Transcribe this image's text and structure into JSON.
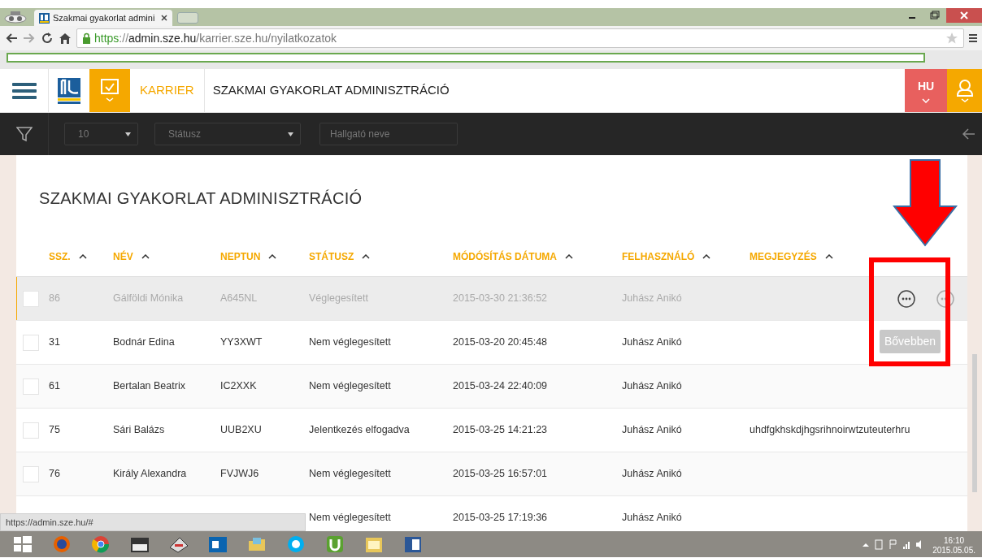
{
  "browser": {
    "tab_title": "Szakmai gyakorlat admini",
    "url": {
      "scheme": "https",
      "sep": "://",
      "host": "admin.sze.hu",
      "path": "/karrier.sze.hu/nyilatkozatok"
    },
    "status_url": "https://admin.sze.hu/#"
  },
  "header": {
    "module": "KARRIER",
    "title": "SZAKMAI GYAKORLAT ADMINISZTRÁCIÓ",
    "language": "HU"
  },
  "filters": {
    "page_size": "10",
    "status": {
      "placeholder": "Státusz"
    },
    "student": {
      "placeholder": "Hallgató neve"
    }
  },
  "page_title": "SZAKMAI GYAKORLAT ADMINISZTRÁCIÓ",
  "table": {
    "columns": [
      "SSZ.",
      "NÉV",
      "NEPTUN",
      "STÁTUSZ",
      "MÓDÓSÍTÁS DÁTUMA",
      "FELHASZNÁLÓ",
      "MEGJEGYZÉS"
    ],
    "rows": [
      {
        "cells": [
          "86",
          "Gálföldi Mónika",
          "A645NL",
          "Véglegesített",
          "2015-03-30 21:36:52",
          "Juhász Anikó",
          ""
        ],
        "selected": true,
        "checked": false
      },
      {
        "cells": [
          "31",
          "Bodnár Edina",
          "YY3XWT",
          "Nem véglegesített",
          "2015-03-20 20:45:48",
          "Juhász Anikó",
          ""
        ],
        "selected": false,
        "checked": false
      },
      {
        "cells": [
          "61",
          "Bertalan Beatrix",
          "IC2XXK",
          "Nem véglegesített",
          "2015-03-24 22:40:09",
          "Juhász Anikó",
          ""
        ],
        "selected": false,
        "checked": false
      },
      {
        "cells": [
          "75",
          "Sári Balázs",
          "UUB2XU",
          "Jelentkezés elfogadva",
          "2015-03-25 14:21:23",
          "Juhász Anikó",
          "uhdfgkhskdjhgsrihnoirwtzuteuterhru"
        ],
        "selected": false,
        "checked": false
      },
      {
        "cells": [
          "76",
          "Király Alexandra",
          "FVJWJ6",
          "Nem véglegesített",
          "2015-03-25 16:57:01",
          "Juhász Anikó",
          ""
        ],
        "selected": false,
        "checked": false
      },
      {
        "cells": [
          "",
          "",
          "",
          "Nem véglegesített",
          "2015-03-25 17:19:36",
          "Juhász Anikó",
          ""
        ],
        "selected": false
      }
    ]
  },
  "tooltip": "Bővebben",
  "taskbar": {
    "time": "16:10",
    "date": "2015.05.05."
  }
}
